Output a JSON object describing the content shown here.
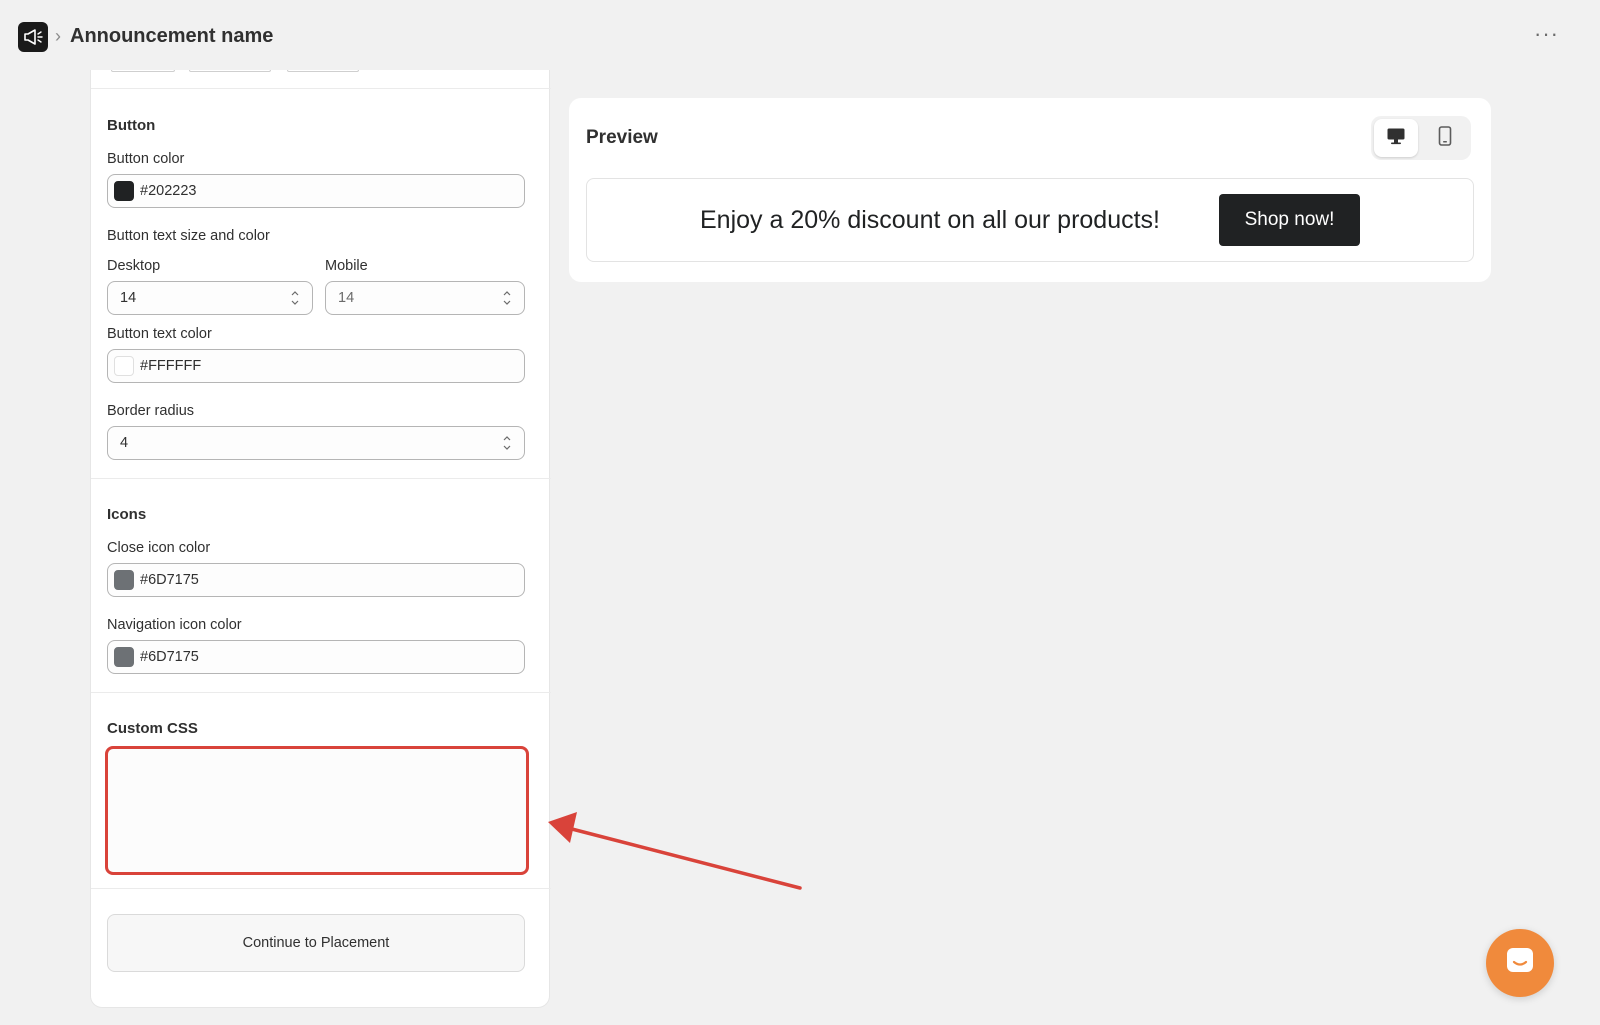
{
  "header": {
    "breadcrumb_separator": "›",
    "title": "Announcement name",
    "more_label": "···"
  },
  "settings": {
    "button_section": {
      "title": "Button",
      "button_color_label": "Button color",
      "button_color_value": "#202223",
      "text_size_label": "Button text size and color",
      "desktop_label": "Desktop",
      "desktop_value": "14",
      "mobile_label": "Mobile",
      "mobile_value": "14",
      "text_color_label": "Button text color",
      "text_color_value": "#FFFFFF",
      "border_radius_label": "Border radius",
      "border_radius_value": "4"
    },
    "icons_section": {
      "title": "Icons",
      "close_icon_label": "Close icon color",
      "close_icon_value": "#6D7175",
      "nav_icon_label": "Navigation icon color",
      "nav_icon_value": "#6D7175"
    },
    "custom_css": {
      "title": "Custom CSS",
      "value": ""
    },
    "continue_label": "Continue to Placement"
  },
  "preview": {
    "title": "Preview",
    "desktop_icon": "desktop-icon",
    "mobile_icon": "mobile-icon",
    "selected_device": "desktop",
    "banner_text": "Enjoy a 20% discount on all our products!",
    "banner_button": "Shop now!"
  },
  "colors": {
    "annotation": "#d9433a",
    "chat": "#f08a3c",
    "button_swatch": "#202223",
    "text_swatch": "#FFFFFF",
    "icon_swatch": "#6D7175"
  }
}
